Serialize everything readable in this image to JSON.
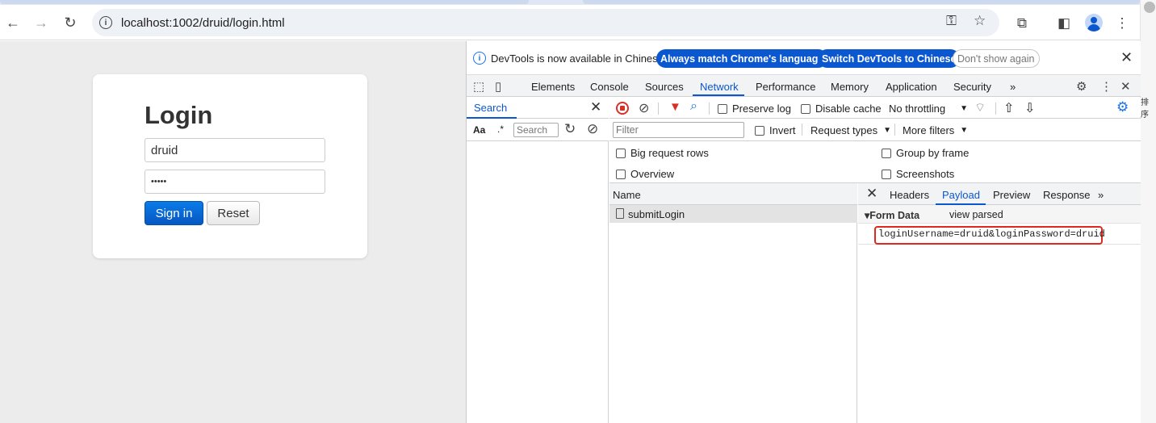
{
  "browser": {
    "url": "localhost:1002/druid/login.html",
    "icons": [
      "back-icon",
      "forward-icon",
      "reload-icon",
      "site-info-icon",
      "key-icon",
      "star-icon",
      "extensions-icon",
      "side-panel-icon",
      "profile-icon",
      "menu-icon"
    ]
  },
  "login": {
    "title": "Login",
    "username_value": "druid",
    "password_value": "•••••",
    "signin_label": "Sign in",
    "reset_label": "Reset"
  },
  "devtools": {
    "infobar": {
      "message": "DevTools is now available in Chinese!",
      "match_label": "Always match Chrome's language",
      "switch_label": "Switch DevTools to Chinese",
      "dismiss_label": "Don't show again"
    },
    "tabs": [
      "Elements",
      "Console",
      "Sources",
      "Network",
      "Performance",
      "Memory",
      "Application",
      "Security"
    ],
    "more_tabs": "»",
    "search": {
      "title": "Search",
      "aa": "Aa",
      "regex": ".*",
      "placeholder": "Search"
    },
    "network": {
      "preserve_log": "Preserve log",
      "disable_cache": "Disable cache",
      "throttling": "No throttling",
      "filter_placeholder": "Filter",
      "invert": "Invert",
      "request_types": "Request types",
      "more_filters": "More filters",
      "big_request_rows": "Big request rows",
      "group_by_frame": "Group by frame",
      "overview": "Overview",
      "screenshots": "Screenshots",
      "name_header": "Name",
      "requests": [
        "submitLogin"
      ]
    },
    "detail": {
      "tabs": [
        "Headers",
        "Payload",
        "Preview",
        "Response"
      ],
      "active_tab": "Payload",
      "more": "»",
      "form_data_label": "▾Form Data",
      "view_parsed": "view parsed",
      "form_value": "loginUsername=druid&loginPassword=druid"
    }
  },
  "edge": {
    "text": "排序"
  },
  "colors": {
    "accent": "#0b57d0",
    "highlight": "#e0281e",
    "signin": "#0a6fe0"
  }
}
